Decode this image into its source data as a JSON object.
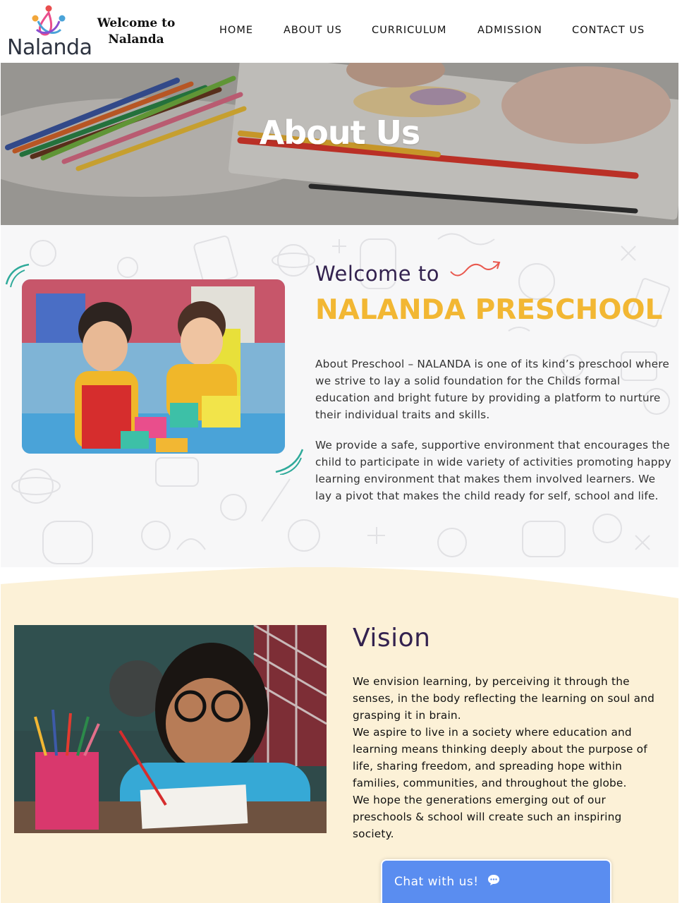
{
  "header": {
    "brand_line1": "Welcome to",
    "brand_line2": "Nalanda",
    "logo_text": "Nalanda",
    "nav": [
      "HOME",
      "ABOUT US",
      "CURRICULUM",
      "ADMISSION",
      "CONTACT US"
    ]
  },
  "hero": {
    "title": "About Us"
  },
  "welcome": {
    "welcome_to": "Welcome to",
    "title": "NALANDA PRESCHOOL",
    "paragraph1": "About Preschool – NALANDA is one of its kind’s preschool where we strive to lay a solid foundation for the Childs formal education and bright future by providing a platform to nurture their individual traits and skills.",
    "paragraph2": "We provide a safe, supportive environment that encourages the child to participate in wide variety of activities promoting happy learning environment that makes them involved learners. We lay a pivot that makes the child ready for self, school and life."
  },
  "vision": {
    "title": "Vision",
    "line1": "We envision learning, by perceiving it through the senses, in the body reflecting the learning on soul and grasping it in brain.",
    "line2": "We aspire to live in a society where education and learning means thinking deeply about the purpose of life, sharing freedom, and spreading hope within families, communities, and throughout the globe.",
    "line3": "We hope the generations emerging out of our preschools & school will create such an inspiring society."
  },
  "chat": {
    "label": "Chat with us!",
    "icon": "chat-bubble-icon"
  },
  "colors": {
    "accent_yellow": "#f2b733",
    "heading_purple": "#33224f",
    "vision_bg": "#fcf1d7",
    "chat_blue": "#5a8df0"
  }
}
